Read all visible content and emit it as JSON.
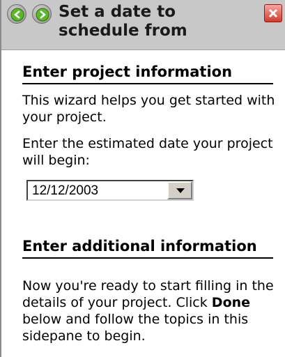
{
  "header": {
    "title": "Set a date to schedule from",
    "back_icon": "back-arrow-icon",
    "forward_icon": "forward-arrow-icon",
    "close_icon": "close-icon"
  },
  "section1": {
    "heading": "Enter project information",
    "intro": "This wizard helps you get started with your project.",
    "date_prompt": "Enter the estimated date your project will begin:",
    "date_value": "12/12/2003"
  },
  "section2": {
    "heading": "Enter additional information",
    "text_before": "Now you're ready to start filling in the details of your project. Click ",
    "text_bold": "Done",
    "text_after": " below and follow the topics in this sidepane to begin."
  },
  "colors": {
    "titlebar": "#c8c8c8",
    "nav_green": "#56b41c",
    "close_red": "#d23a2e"
  }
}
